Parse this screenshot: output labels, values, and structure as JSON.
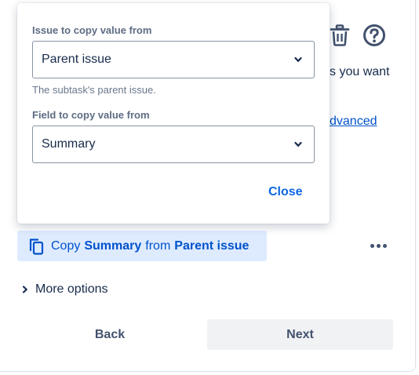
{
  "background": {
    "partial_text": "s you want",
    "partial_link": "dvanced",
    "action_chip": {
      "prefix": "Copy",
      "field": "Summary",
      "middle": "from",
      "source": "Parent issue"
    },
    "more_options_label": "More options",
    "back_label": "Back",
    "next_label": "Next"
  },
  "popup": {
    "issue_label": "Issue to copy value from",
    "issue_value": "Parent issue",
    "issue_helper": "The subtask's parent issue.",
    "field_label": "Field to copy value from",
    "field_value": "Summary",
    "close_label": "Close"
  },
  "icons": [
    "trash-icon",
    "help-icon",
    "copy-icon",
    "more-icon",
    "chevron-right-icon",
    "chevron-down-icon"
  ],
  "colors": {
    "link": "#0052cc",
    "chip_bg": "#deebff",
    "close": "#0c66e4",
    "next_bg": "#f1f2f4"
  }
}
